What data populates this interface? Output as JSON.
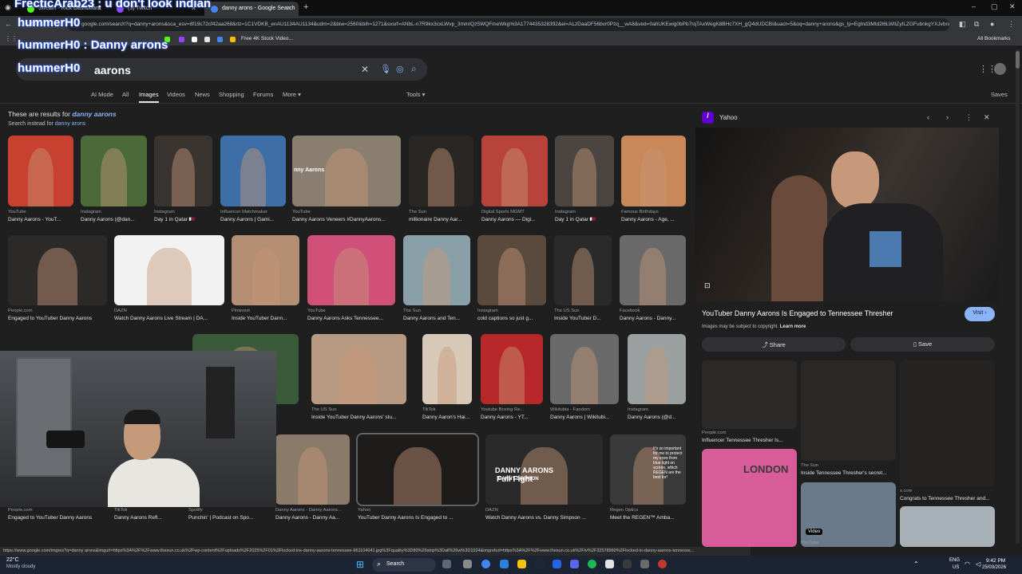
{
  "stream_overlay": {
    "line1": "FrecticArab23 : u don't look indian",
    "line2": "hummerH0",
    "line3_user": "hummerH0",
    "line3_msg": ": Danny arrons",
    "line4_user": "hummerH0",
    "line4_msg": ": aarons"
  },
  "browser": {
    "tabs": [
      {
        "label": "Stream - Kick Dashboard",
        "color": "#53fc18"
      },
      {
        "label": "(3) Twitch",
        "color": "#9146ff"
      },
      {
        "label": "danny arons - Google Search",
        "color": "#4285f4"
      }
    ],
    "url": "google.com/search?q=danny+arons&sca_esv=8f19c72cf42aa268&rlz=1C1VDKB_enAU1134AU1134&udm=2&biw=2560&bih=1271&sxsrf=ANbL-n7R9kx3cxLWvp_3mmIQz5WQFmeWkg%3A1774435328392&ei=ALzDaaDF56bvr0Pzq__wA8&ved=0ahUKEwig0bPb7rqTAxWegK8BHc7XH_gQ4dUDCBI&uact=5&oq=danny+arons&gs_lp=Egtnd3Mtd2l6LWltZyILZGFubnkgYXJvbnM",
    "bookmark_label": "Free 4K Stock Video...",
    "all_bookmarks": "All Bookmarks",
    "window_controls": [
      "–",
      "▢",
      "✕"
    ]
  },
  "search": {
    "query": "aarons",
    "nav": [
      "AI Mode",
      "All",
      "Images",
      "Videos",
      "News",
      "Shopping",
      "Forums",
      "More ▾"
    ],
    "active_nav": "Images",
    "tools": "Tools ▾",
    "saves": "Saves",
    "results_for_prefix": "These are results for",
    "results_for_term": "danny aarons",
    "search_instead_prefix": "Search instead for",
    "search_instead_term": "danny arons"
  },
  "results": [
    {
      "source": "YouTube",
      "title": "Danny Aarons - YouT...",
      "color": "#c84030"
    },
    {
      "source": "Instagram",
      "title": "Danny Aarons (@dan...",
      "color": "#4a6a3a"
    },
    {
      "source": "Instagram",
      "title": "Day 1 in Qatar 🇶🇦",
      "color": "#3a3430"
    },
    {
      "source": "Influencer Matchmaker",
      "title": "Danny Aarons | Gami...",
      "color": "#3d6fa6"
    },
    {
      "source": "YouTube",
      "title": "Danny Aarons Veneers #DannyAarons...",
      "color": "#8a7e70"
    },
    {
      "source": "The Sun",
      "title": "millionaire Danny Aar...",
      "color": "#2a2623"
    },
    {
      "source": "Digital Sports MGMT",
      "title": "Danny Aarons — Digi...",
      "color": "#b8433a"
    },
    {
      "source": "Instagram",
      "title": "Day 1 in Qatar 🇶🇦",
      "color": "#4a4540"
    },
    {
      "source": "Famous Birthdays",
      "title": "Danny Aarons - Age, ...",
      "color": "#c8885a"
    },
    {
      "source": "People.com",
      "title": "Engaged to YouTuber Danny Aarons",
      "color": "#2c2a28"
    },
    {
      "source": "DAZN",
      "title": "Watch Danny Aarons Live Stream | DA...",
      "color": "#f2f2f2"
    },
    {
      "source": "Pinterest",
      "title": "Inside YouTuber Dann...",
      "color": "#b48e72"
    },
    {
      "source": "YouTube",
      "title": "Danny Aarons Asks Tennessee...",
      "color": "#d0507a"
    },
    {
      "source": "The Sun",
      "title": "Danny Aarons and Ten...",
      "color": "#8aa0a8"
    },
    {
      "source": "Instagram",
      "title": "cold captions so just g...",
      "color": "#5a4a3e"
    },
    {
      "source": "The US Sun",
      "title": "Inside YouTuber D...",
      "color": "#2a2a2a"
    },
    {
      "source": "Facebook",
      "title": "Danny Aarons - Danny...",
      "color": "#6a6a6a"
    },
    {
      "source": "",
      "title": "'s Debu...",
      "color": "#3a5a3a"
    },
    {
      "source": "The US Sun",
      "title": "Inside YouTuber Danny Aarons' stu...",
      "color": "#b89a82"
    },
    {
      "source": "TikTok",
      "title": "Danny Aaron's Hai...",
      "color": "#d8c8b8"
    },
    {
      "source": "Youtube Boxing Re...",
      "title": "Danny Aarons - YT...",
      "color": "#b8282a"
    },
    {
      "source": "Wikitubia - Fandom",
      "title": "Danny Aarons | Wikitubi...",
      "color": "#6a6a6a"
    },
    {
      "source": "Instagram",
      "title": "Danny Aarons (@d...",
      "color": "#9aa0a0"
    },
    {
      "source": "People.com",
      "title": "Engaged to YouTuber Danny Aarons",
      "color": "#2c2a28"
    },
    {
      "source": "TikTok",
      "title": "Danny Aarons Refl...",
      "color": "#6a5a4a"
    },
    {
      "source": "Spotify",
      "title": "Punchin' | Podcast on Spo...",
      "color": "#3a3a3a"
    },
    {
      "source": "Danny Aarons - Danny Aarons...",
      "title": "Danny Aarons - Danny Aa...",
      "color": "#8a7a6a"
    },
    {
      "source": "Yahoo",
      "title": "YouTuber Danny Aarons Is Engaged to ...",
      "color": "#1e1c1a"
    },
    {
      "source": "DAZN",
      "title": "Watch Danny Aarons vs. Danny Simpson ...",
      "color": "#2a2a2a"
    },
    {
      "source": "Regen Optics",
      "title": "Meet the REGEN™ Amba...",
      "color": "#3a3a3a"
    }
  ],
  "thumb_text": {
    "danny_aarons": "nny Aarons",
    "fullfight_name": "DANNY AARONS",
    "fullfight_vs": "DANNY SIMPSON",
    "fullfight_label": "Full Fight",
    "regen_text": "It's so important for me to protect my eyes from blue light on screen, which REGEN are the best for!",
    "london": "LONDON"
  },
  "panel": {
    "source": "Yahoo",
    "title": "YouTuber Danny Aarons Is Engaged to Tennessee Thresher",
    "visit": "Visit ›",
    "copyright_prefix": "Images may be subject to copyright.",
    "learn_more": "Learn more",
    "share": "Share",
    "save": "Save",
    "related": [
      {
        "source": "People.com",
        "title": "Influencer Tennessee Thresher Is..."
      },
      {
        "source": "The Sun",
        "title": "Inside Tennessee Thresher's secret..."
      },
      {
        "source": "x.com",
        "title": "Congrats to Tennessee Thresher and..."
      },
      {
        "source": "YouTube",
        "title": "Video"
      }
    ]
  },
  "status_url": "https://www.google.com/imgres?q=danny arons&imgurl=https%3A%2F%2Fwww.thesun.co.uk%2Fwp-content%2Fuploads%2F2025%2F01%2Flocked-ins-danny-aarons-tennessee-961104041.jpg%3Fquality%3D80%26strip%3Dall%26w%3D1024&imgrefurl=https%3A%2F%2Fwww.thesun.co.uk%2Ftv%2F32578960%2Flocked-in-danny-aarons-tennesse...",
  "taskbar": {
    "weather_temp": "22°C",
    "weather_desc": "Mostly cloudy",
    "search": "Search",
    "lang": "ENG",
    "region": "US",
    "time": "9:42 PM",
    "date": "25/03/2026"
  }
}
